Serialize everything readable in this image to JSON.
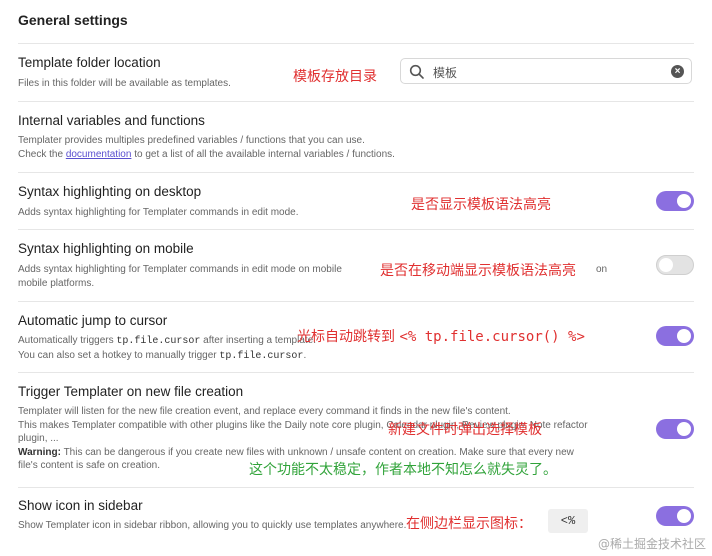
{
  "section_title": "General settings",
  "settings": [
    {
      "name": "Template folder location",
      "desc": "Files in this folder will be available as templates.",
      "annotation": "模板存放目录",
      "search": {
        "value": "模板",
        "clear_glyph": "×"
      }
    },
    {
      "name": "Internal variables and functions",
      "desc_line1": "Templater provides multiples predefined variables / functions that you can use.",
      "desc_line2_pre": "Check the ",
      "desc_link": "documentation",
      "desc_line2_post": " to get a list of all the available internal variables / functions."
    },
    {
      "name": "Syntax highlighting on desktop",
      "desc": "Adds syntax highlighting for Templater commands in edit mode.",
      "annotation": "是否显示模板语法高亮",
      "toggle": "on"
    },
    {
      "name": "Syntax highlighting on mobile",
      "desc_line1": "Adds syntax highlighting for Templater commands in edit mode on mobile",
      "desc_line1_tail": "on",
      "desc_line2": "mobile platforms.",
      "annotation": "是否在移动端显示模板语法高亮",
      "toggle": "off"
    },
    {
      "name": "Automatic jump to cursor",
      "desc_line1_pre": "Automatically triggers ",
      "desc_code1": "tp.file.cursor",
      "desc_line1_post": " after inserting a template.",
      "desc_line2_pre": "You can also set a hotkey to manually trigger ",
      "desc_code2": "tp.file.cursor",
      "desc_line2_post": ".",
      "annotation_pre": "光标自动跳转到 ",
      "annotation_code": "<% tp.file.cursor() %>",
      "toggle": "on"
    },
    {
      "name": "Trigger Templater on new file creation",
      "desc_line1": "Templater will listen for the new file creation event, and replace every command it finds in the new file's content.",
      "desc_line2": "This makes Templater compatible with other plugins like the Daily note core plugin, Calendar plugin, Review plugin, Note refactor",
      "desc_line3": "plugin, ...",
      "desc_warning_label": "Warning:",
      "desc_warning_text": " This can be dangerous if you create new files with unknown / unsafe content on creation. Make sure that every new",
      "desc_line5": "file's content is safe on creation.",
      "annotation": "新建文件时弹出选择模板",
      "annotation2": "这个功能不太稳定，作者本地不知怎么就失灵了。",
      "toggle": "on"
    },
    {
      "name": "Show icon in sidebar",
      "desc": "Show Templater icon in sidebar ribbon, allowing you to quickly use templates anywhere.",
      "annotation": "在侧边栏显示图标：",
      "badge": "<%",
      "toggle": "on"
    }
  ],
  "watermark": "@稀土掘金技术社区",
  "colors": {
    "accent": "#8b6fe0",
    "annotation_red": "#e03030",
    "annotation_green": "#31a33a",
    "link": "#5a4fcf"
  }
}
